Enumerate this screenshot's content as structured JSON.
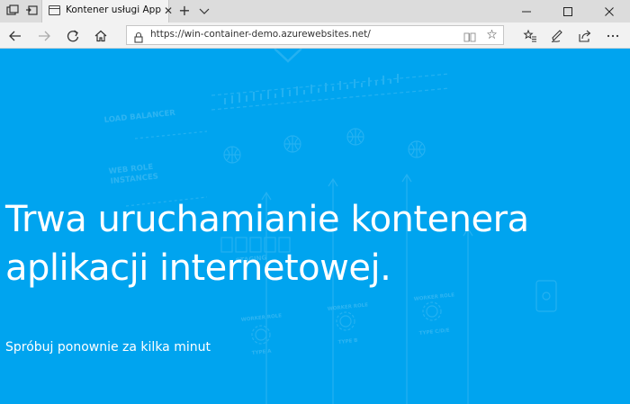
{
  "browser": {
    "tab": {
      "title": "Kontener usługi App Se",
      "close_glyph": "✕",
      "favicon": "page-icon"
    },
    "new_tab_glyph": "+",
    "address": {
      "url": "https://win-container-demo.azurewebsites.net/",
      "star_glyph": "☆"
    },
    "icons": [
      "tab-preview-icon",
      "set-aside-tabs-icon",
      "tab-list-chevron-icon",
      "back-icon",
      "forward-icon",
      "refresh-icon",
      "home-icon",
      "lock-icon",
      "reading-view-icon",
      "favorite-star-icon",
      "favorites-hub-icon",
      "notes-pen-icon",
      "share-icon",
      "more-dots-icon",
      "minimize-icon",
      "maximize-icon",
      "close-window-icon"
    ]
  },
  "page": {
    "background_color": "#00a4ef",
    "headline": "Trwa uruchamianie kontenera aplikacji internetowej.",
    "subtext": "Spróbuj ponownie za kilka minut",
    "background_labels": {
      "load_balancer": "LOAD BALANCER",
      "web_role_1": "WEB ROLE",
      "web_role_2": "INSTANCES",
      "staging": "STAGING",
      "worker_role_a": "WORKER ROLE",
      "worker_role_b": "WORKER ROLE",
      "worker_role_c": "WORKER ROLE",
      "type_a": "TYPE A",
      "type_b": "TYPE B",
      "type_c": "TYPE C/D/E"
    }
  }
}
